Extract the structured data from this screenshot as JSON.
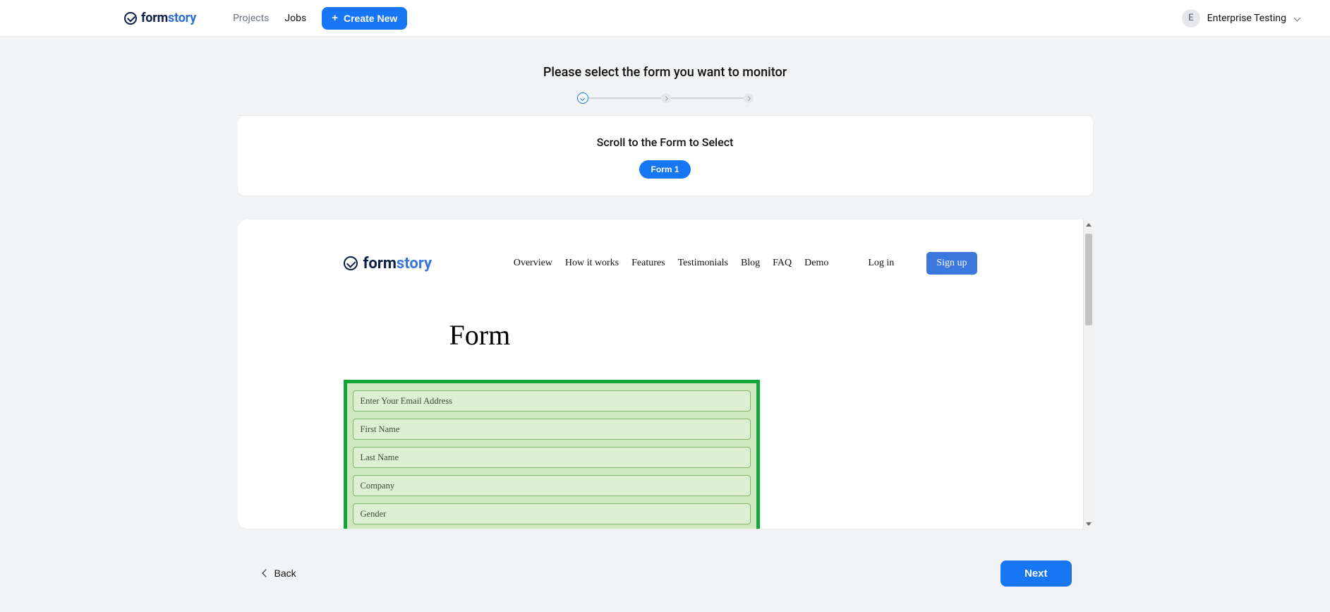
{
  "header": {
    "logo_text_1": "form",
    "logo_text_2": "story",
    "nav": {
      "projects": "Projects",
      "jobs": "Jobs"
    },
    "create_btn": "Create New",
    "account_initial": "E",
    "account_name": "Enterprise Testing"
  },
  "wizard": {
    "title": "Please select the form you want to monitor",
    "hint_title": "Scroll to the Form to Select",
    "pill": "Form 1"
  },
  "preview": {
    "logo_text_1": "form",
    "logo_text_2": "story",
    "nav": {
      "overview": "Overview",
      "how": "How it works",
      "features": "Features",
      "testimonials": "Testimonials",
      "blog": "Blog",
      "faq": "FAQ",
      "demo": "Demo"
    },
    "login": "Log in",
    "signup": "Sign up",
    "form_heading": "Form",
    "fields": {
      "email": "Enter Your Email Address",
      "first": "First Name",
      "last": "Last Name",
      "company": "Company",
      "gender": "Gender"
    }
  },
  "footer": {
    "back": "Back",
    "next": "Next"
  }
}
